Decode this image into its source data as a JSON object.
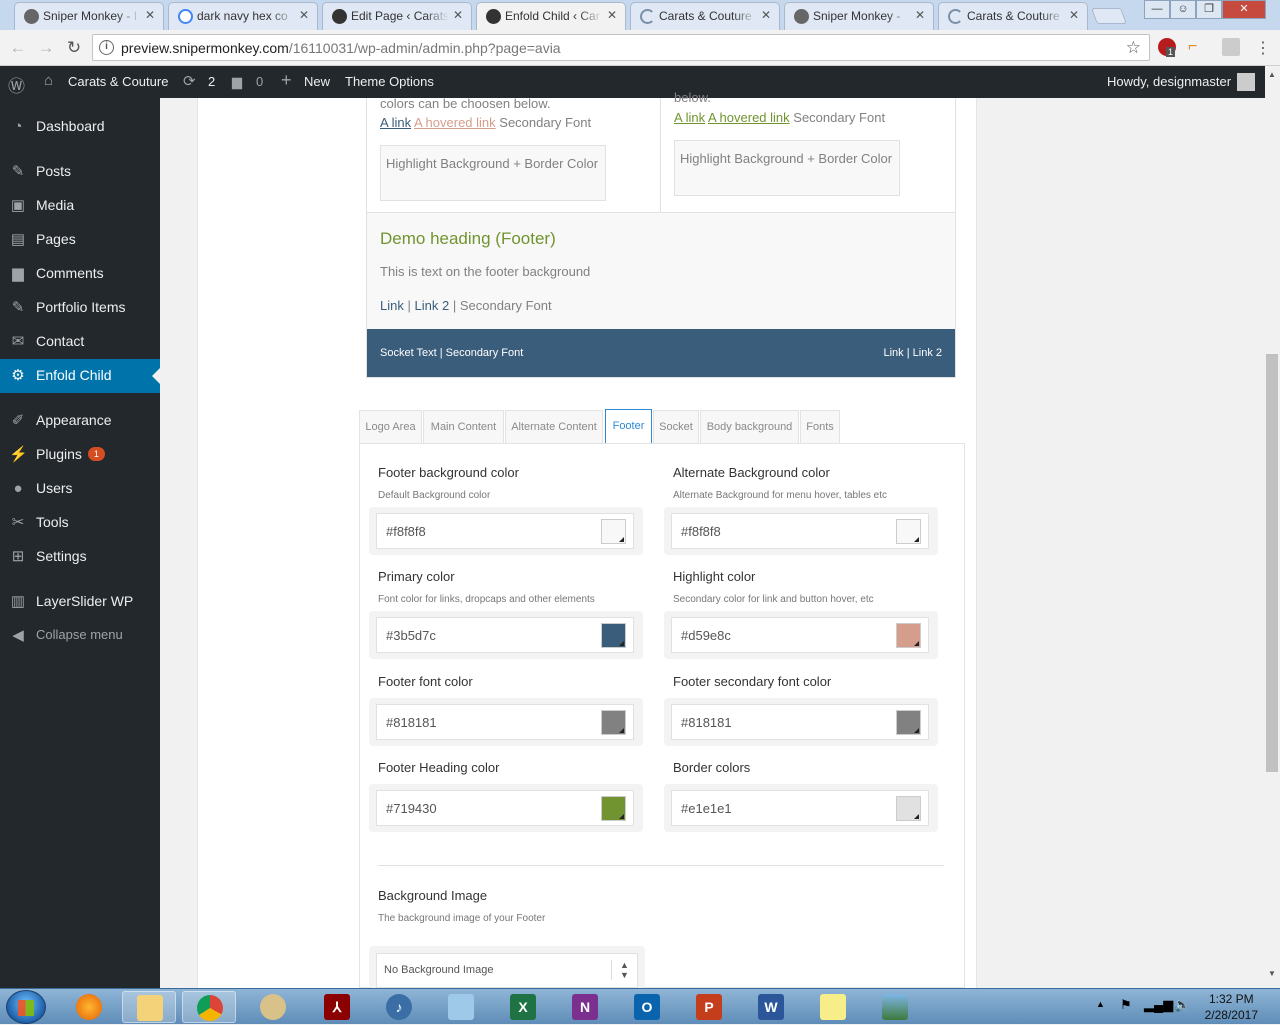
{
  "browser": {
    "tabs": [
      {
        "title": "Sniper Monkey - I",
        "icon": "monkey-favicon"
      },
      {
        "title": "dark navy hex co",
        "icon": "google-favicon"
      },
      {
        "title": "Edit Page ‹ Carats",
        "icon": "wp-favicon"
      },
      {
        "title": "Enfold Child ‹ Car",
        "icon": "wp-favicon",
        "active": true
      },
      {
        "title": "Carats & Couture",
        "icon": "loading-favicon"
      },
      {
        "title": "Sniper Monkey -",
        "icon": "monkey-favicon"
      },
      {
        "title": "Carats & Couture",
        "icon": "loading-favicon"
      }
    ],
    "url_host": "preview.snipermonkey.com",
    "url_path": "/16110031/wp-admin/admin.php?page=avia",
    "ext_badge": "1"
  },
  "adminbar": {
    "site_name": "Carats & Couture",
    "updates_count": "2",
    "comments_count": "0",
    "new_label": "New",
    "theme_options_label": "Theme Options",
    "howdy": "Howdy, designmaster"
  },
  "sidebar": {
    "items": [
      {
        "label": "Dashboard",
        "icon": "dashboard-icon"
      },
      {
        "label": "Posts",
        "icon": "pin-icon"
      },
      {
        "label": "Media",
        "icon": "media-icon"
      },
      {
        "label": "Pages",
        "icon": "pages-icon"
      },
      {
        "label": "Comments",
        "icon": "comments-icon"
      },
      {
        "label": "Portfolio Items",
        "icon": "pin-icon"
      },
      {
        "label": "Contact",
        "icon": "mail-icon"
      },
      {
        "label": "Enfold Child",
        "icon": "gear-icon"
      },
      {
        "label": "Appearance",
        "icon": "brush-icon"
      },
      {
        "label": "Plugins",
        "icon": "plugin-icon",
        "badge": "1"
      },
      {
        "label": "Users",
        "icon": "user-icon"
      },
      {
        "label": "Tools",
        "icon": "wrench-icon"
      },
      {
        "label": "Settings",
        "icon": "settings-icon"
      },
      {
        "label": "LayerSlider WP",
        "icon": "layers-icon"
      },
      {
        "label": "Collapse menu",
        "icon": "collapse-icon"
      }
    ]
  },
  "preview": {
    "left": {
      "text_line": "colors can be choosen below.",
      "link": "A link",
      "hovered_link": "A hovered link",
      "secondary": "Secondary Font",
      "highlight_box": "Highlight Background + Border Color"
    },
    "right": {
      "text_line": "below.",
      "link": "A link",
      "hovered_link": "A hovered link",
      "secondary": "Secondary Font",
      "highlight_box": "Highlight Background + Border Color"
    },
    "footer": {
      "heading": "Demo heading (Footer)",
      "text": "This is text on the footer background",
      "link1": "Link",
      "sep1": "|",
      "link2": "Link 2",
      "sep2": "|",
      "secondary": "Secondary Font"
    },
    "socket": {
      "text": "Socket Text | Secondary Font",
      "links": "Link | Link 2"
    }
  },
  "options_tabs": [
    "Logo Area",
    "Main Content",
    "Alternate Content",
    "Footer",
    "Socket",
    "Body background",
    "Fonts"
  ],
  "active_tab": "Footer",
  "fields": [
    {
      "label": "Footer background color",
      "desc": "Default Background color",
      "value": "#f8f8f8",
      "swatch": "#f8f8f8"
    },
    {
      "label": "Alternate Background color",
      "desc": "Alternate Background for menu hover, tables etc",
      "value": "#f8f8f8",
      "swatch": "#f8f8f8"
    },
    {
      "label": "Primary color",
      "desc": "Font color for links, dropcaps and other elements",
      "value": "#3b5d7c",
      "swatch": "#3b5d7c"
    },
    {
      "label": "Highlight color",
      "desc": "Secondary color for link and button hover, etc",
      "value": "#d59e8c",
      "swatch": "#d59e8c"
    },
    {
      "label": "Footer font color",
      "desc": "",
      "value": "#818181",
      "swatch": "#818181"
    },
    {
      "label": "Footer secondary font color",
      "desc": "",
      "value": "#818181",
      "swatch": "#818181"
    },
    {
      "label": "Footer Heading color",
      "desc": "",
      "value": "#719430",
      "swatch": "#719430"
    },
    {
      "label": "Border colors",
      "desc": "",
      "value": "#e1e1e1",
      "swatch": "#e1e1e1"
    }
  ],
  "background_image": {
    "label": "Background Image",
    "desc": "The background image of your Footer",
    "selected": "No Background Image"
  },
  "colors": {
    "wp_dark": "#23282d",
    "wp_blue": "#0073aa",
    "socket": "#3b5d7c",
    "tab_active": "#2d8ad6"
  },
  "taskbar": {
    "apps": [
      "firefox",
      "explorer",
      "chrome",
      "paint",
      "acrobat",
      "itunes",
      "notepad",
      "excel",
      "onenote",
      "outlook",
      "powerpoint",
      "word",
      "sticky-notes",
      "photos"
    ],
    "time": "1:32 PM",
    "date": "2/28/2017"
  }
}
